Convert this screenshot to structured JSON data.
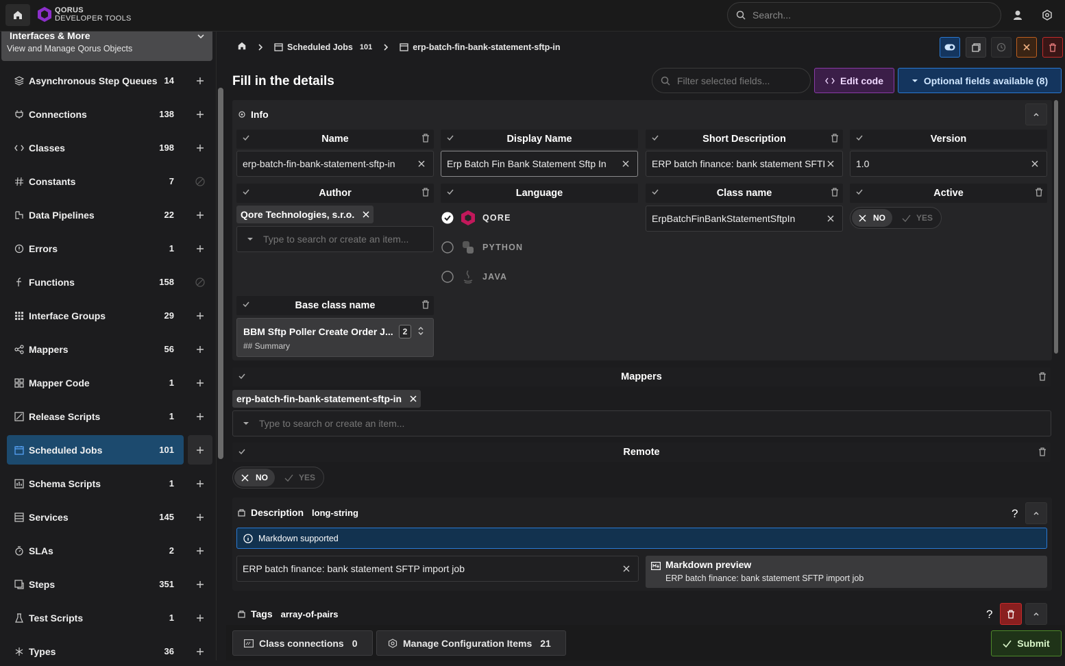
{
  "app": {
    "logo_line1": "QORUS",
    "logo_line2": "DEVELOPER TOOLS",
    "search_placeholder": "Search..."
  },
  "sidebar": {
    "header_title": "Interfaces & More",
    "header_subtitle": "View and Manage Qorus Objects",
    "items": [
      {
        "label": "Asynchronous Step Queues",
        "count": "14",
        "icon": "layers-icon",
        "action": "add"
      },
      {
        "label": "Connections",
        "count": "138",
        "icon": "plug-icon",
        "action": "add"
      },
      {
        "label": "Classes",
        "count": "198",
        "icon": "code-icon",
        "action": "add"
      },
      {
        "label": "Constants",
        "count": "7",
        "icon": "hash-icon",
        "action": "disabled"
      },
      {
        "label": "Data Pipelines",
        "count": "22",
        "icon": "pipeline-icon",
        "action": "add"
      },
      {
        "label": "Errors",
        "count": "1",
        "icon": "error-icon",
        "action": "add"
      },
      {
        "label": "Functions",
        "count": "158",
        "icon": "function-icon",
        "action": "disabled"
      },
      {
        "label": "Interface Groups",
        "count": "29",
        "icon": "grid-icon",
        "action": "add"
      },
      {
        "label": "Mappers",
        "count": "56",
        "icon": "share-icon",
        "action": "add"
      },
      {
        "label": "Mapper Code",
        "count": "1",
        "icon": "apps-icon",
        "action": "add"
      },
      {
        "label": "Release Scripts",
        "count": "1",
        "icon": "script-icon",
        "action": "add"
      },
      {
        "label": "Scheduled Jobs",
        "count": "101",
        "icon": "calendar-icon",
        "action": "add"
      },
      {
        "label": "Schema Scripts",
        "count": "1",
        "icon": "schema-icon",
        "action": "add"
      },
      {
        "label": "Services",
        "count": "145",
        "icon": "services-icon",
        "action": "add"
      },
      {
        "label": "SLAs",
        "count": "2",
        "icon": "stopwatch-icon",
        "action": "add"
      },
      {
        "label": "Steps",
        "count": "351",
        "icon": "step-icon",
        "action": "add"
      },
      {
        "label": "Test Scripts",
        "count": "1",
        "icon": "flask-icon",
        "action": "add"
      },
      {
        "label": "Types",
        "count": "36",
        "icon": "asterisk-icon",
        "action": "add"
      }
    ]
  },
  "breadcrumb": {
    "section": "Scheduled Jobs",
    "section_count": "101",
    "current": "erp-batch-fin-bank-statement-sftp-in"
  },
  "form": {
    "title": "Fill in the details",
    "filter_placeholder": "Filter selected fields...",
    "edit_code": "Edit code",
    "optional_fields": "Optional fields available (8)",
    "info_label": "Info",
    "name_label": "Name",
    "name_value": "erp-batch-fin-bank-statement-sftp-in",
    "display_name_label": "Display Name",
    "display_name_value": "Erp Batch Fin Bank Statement Sftp In",
    "short_desc_label": "Short Description",
    "short_desc_value": "ERP batch finance: bank statement SFTP import job",
    "version_label": "Version",
    "version_value": "1.0",
    "author_label": "Author",
    "author_tag": "Qore Technologies, s.r.o.",
    "author_placeholder": "Type to search or create an item...",
    "language_label": "Language",
    "lang_qore": "QORE",
    "lang_python": "PYTHON",
    "lang_java": "JAVA",
    "class_name_label": "Class name",
    "class_name_value": "ErpBatchFinBankStatementSftpIn",
    "active_label": "Active",
    "no": "NO",
    "yes": "YES",
    "base_class_label": "Base class name",
    "base_class_value": "BBM Sftp Poller Create Order J...",
    "base_class_count": "2",
    "base_class_summary": "## Summary",
    "mappers_label": "Mappers",
    "mappers_tag": "erp-batch-fin-bank-statement-sftp-in",
    "mappers_placeholder": "Type to search or create an item...",
    "remote_label": "Remote",
    "description_label": "Description",
    "description_type": "long-string",
    "markdown_supported": "Markdown supported",
    "description_value": "ERP batch finance: bank statement SFTP import job",
    "markdown_preview_title": "Markdown preview",
    "markdown_preview_text": "ERP batch finance: bank statement SFTP import job",
    "tags_label": "Tags",
    "tags_type": "array-of-pairs"
  },
  "footer": {
    "class_connections": "Class connections",
    "class_connections_count": "0",
    "manage_config": "Manage Configuration Items",
    "manage_config_count": "21",
    "submit": "Submit"
  },
  "colors": {
    "accent_blue": "#2a7ad4",
    "active_item": "#1c4a6e",
    "edit_purple": "#8a3aa8",
    "submit_green": "#4e8a2a",
    "danger": "#c42b2b",
    "qore_brand": "#c2185b"
  }
}
